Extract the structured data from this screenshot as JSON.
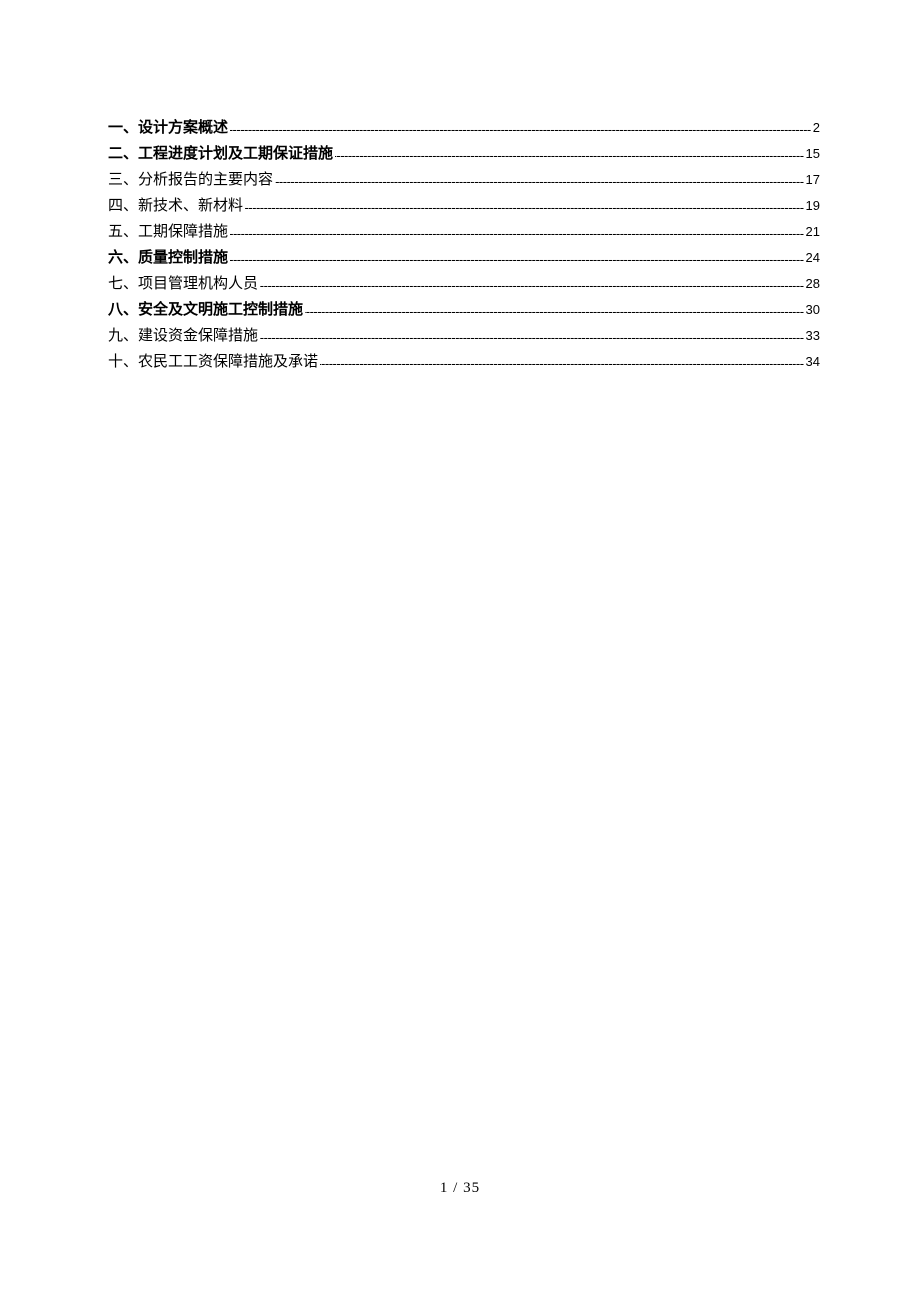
{
  "toc": [
    {
      "title": "一、设计方案概述",
      "page": "2",
      "bold": true
    },
    {
      "title": "二、工程进度计划及工期保证措施",
      "page": "15",
      "bold": true
    },
    {
      "title": "三、分析报告的主要内容",
      "page": "17",
      "bold": false
    },
    {
      "title": "四、新技术、新材料",
      "page": "19",
      "bold": false
    },
    {
      "title": "五、工期保障措施",
      "page": "21",
      "bold": false
    },
    {
      "title": "六、质量控制措施",
      "page": "24",
      "bold": true
    },
    {
      "title": "七、项目管理机构人员",
      "page": "28",
      "bold": false
    },
    {
      "title": "八、安全及文明施工控制措施",
      "page": "30",
      "bold": true
    },
    {
      "title": "九、建设资金保障措施",
      "page": "33",
      "bold": false
    },
    {
      "title": "十、农民工工资保障措施及承诺",
      "page": "34",
      "bold": false
    }
  ],
  "footer": {
    "current_page": "1",
    "separator": " / ",
    "total_pages": "35"
  }
}
